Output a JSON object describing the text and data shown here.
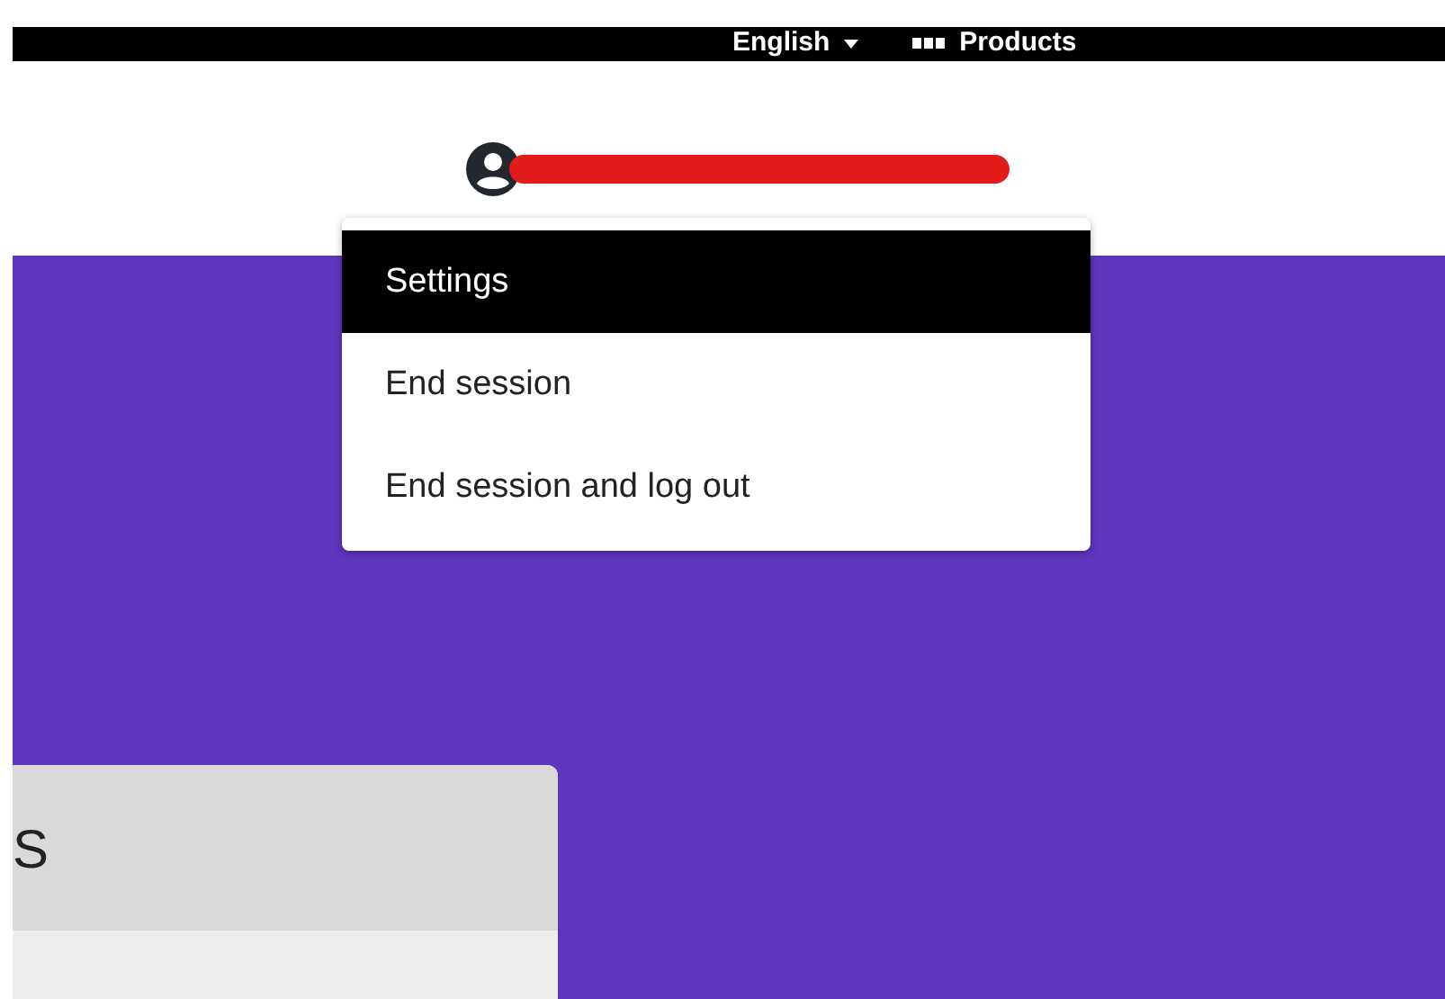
{
  "top_bar": {
    "language": "English",
    "products": "Products"
  },
  "user_menu": {
    "items": [
      {
        "label": "Settings",
        "selected": true
      },
      {
        "label": "End session",
        "selected": false
      },
      {
        "label": "End session and log out",
        "selected": false
      }
    ]
  },
  "card": {
    "title": "S"
  }
}
